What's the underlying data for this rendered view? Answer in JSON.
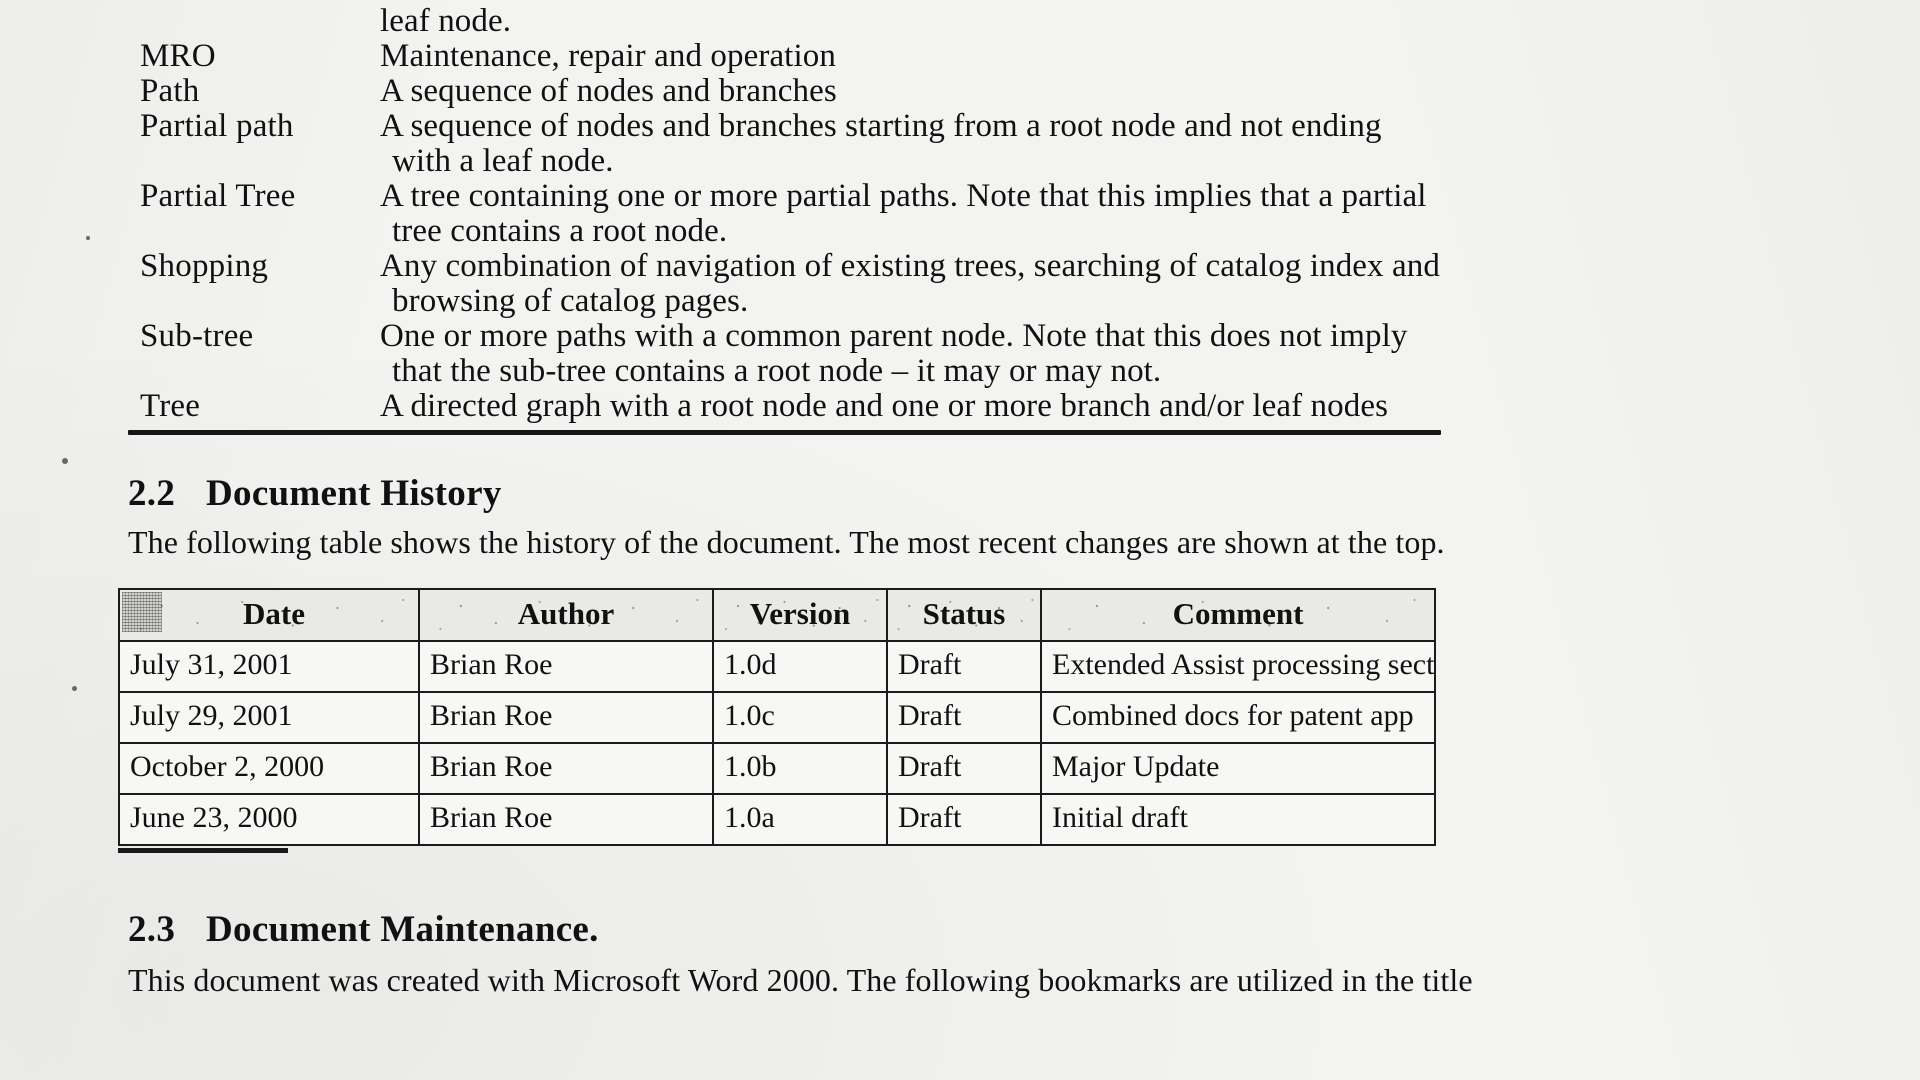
{
  "glossary": {
    "rows": [
      {
        "term": "",
        "definition": "leaf node.",
        "continuation": ""
      },
      {
        "term": "MRO",
        "definition": "Maintenance, repair and operation",
        "continuation": ""
      },
      {
        "term": "Path",
        "definition": "A sequence of nodes and branches",
        "continuation": ""
      },
      {
        "term": "Partial path",
        "definition": "A sequence of nodes and branches starting from a root node and not ending",
        "continuation": "with a leaf node."
      },
      {
        "term": "Partial Tree",
        "definition": "A tree containing one or more partial paths.  Note that this implies that a partial",
        "continuation": "tree contains a root node."
      },
      {
        "term": "Shopping",
        "definition": "Any combination of navigation of existing trees, searching of catalog index and",
        "continuation": "browsing of catalog pages."
      },
      {
        "term": "Sub-tree",
        "definition": "One or more paths with a common parent node.  Note that this does not imply",
        "continuation": "that the sub-tree contains a root node – it may or may not."
      },
      {
        "term": "Tree",
        "definition": "A directed graph with a root node and one or more branch and/or leaf nodes",
        "continuation": ""
      }
    ]
  },
  "section_history": {
    "number": "2.2",
    "title": "Document History",
    "intro": "The following table shows the history of the document.  The most recent changes are shown at the top."
  },
  "history_table": {
    "columns": [
      "Date",
      "Author",
      "Version",
      "Status",
      "Comment"
    ],
    "rows": [
      {
        "date": "July 31, 2001",
        "author": "Brian Roe",
        "version": "1.0d",
        "status": "Draft",
        "comment": "Extended Assist processing section"
      },
      {
        "date": "July 29, 2001",
        "author": "Brian Roe",
        "version": "1.0c",
        "status": "Draft",
        "comment": "Combined docs for patent app"
      },
      {
        "date": "October 2, 2000",
        "author": "Brian Roe",
        "version": "1.0b",
        "status": "Draft",
        "comment": "Major Update"
      },
      {
        "date": "June 23, 2000",
        "author": "Brian Roe",
        "version": "1.0a",
        "status": "Draft",
        "comment": "Initial draft"
      }
    ]
  },
  "section_maintenance": {
    "number": "2.3",
    "title": "Document Maintenance.",
    "intro": "This document was created with Microsoft Word 2000. The following bookmarks are utilized in the title"
  }
}
